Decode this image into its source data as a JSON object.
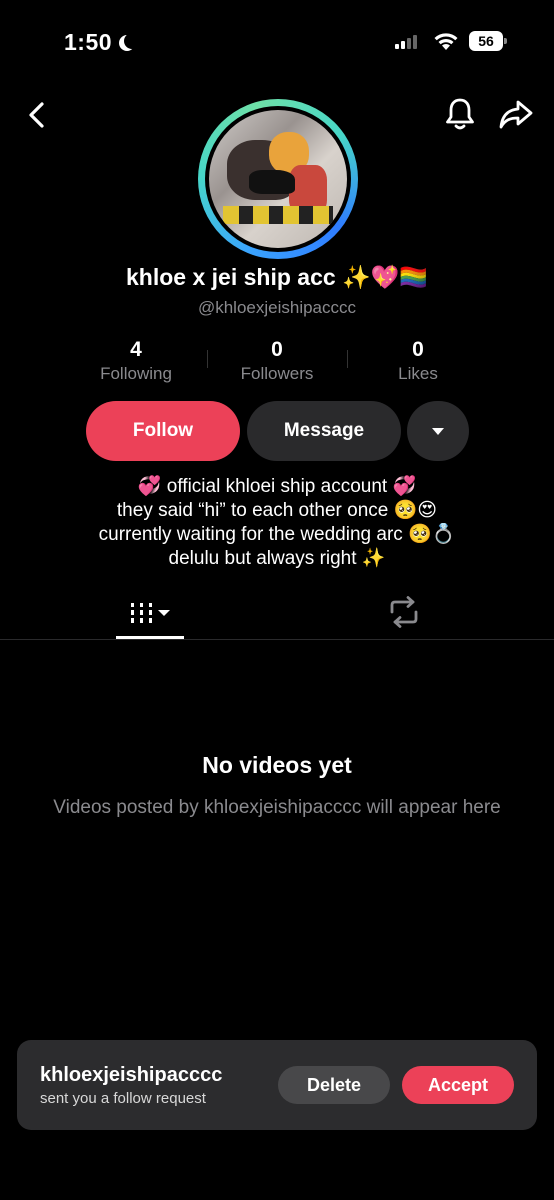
{
  "status_bar": {
    "time": "1:50",
    "battery": "56",
    "icons": [
      "moon-icon",
      "signal-icon",
      "wifi-icon",
      "battery-icon"
    ]
  },
  "nav": {
    "icons": [
      "back-icon",
      "bell-icon",
      "share-icon"
    ]
  },
  "profile": {
    "display_name": "khloe x jei ship acc ✨💖🏳️‍🌈",
    "username": "@khloexjeishipacccc",
    "stats": [
      {
        "value": "4",
        "label": "Following"
      },
      {
        "value": "0",
        "label": "Followers"
      },
      {
        "value": "0",
        "label": "Likes"
      }
    ],
    "bio": [
      "💞 official khloei ship account 💞",
      "they said “hi” to each other once 🥺😍",
      "currently waiting for the wedding arc 🥺💍",
      "delulu but always right ✨"
    ]
  },
  "actions": {
    "follow_label": "Follow",
    "message_label": "Message",
    "more_icon": "caret-down-icon"
  },
  "tabs": {
    "icons": [
      "videos-grid-icon",
      "repost-icon"
    ]
  },
  "empty_state": {
    "title": "No videos yet",
    "subtitle": "Videos posted by khloexjeishipacccc will appear here"
  },
  "follow_request": {
    "username": "khloexjeishipacccc",
    "message": "sent you a follow request",
    "delete_label": "Delete",
    "accept_label": "Accept"
  },
  "colors": {
    "accent": "#ec4158",
    "background": "#000000",
    "secondary_button": "#2a2a2c",
    "muted_text": "#8a8a8e",
    "avatar_ring": "#47d6c8"
  }
}
